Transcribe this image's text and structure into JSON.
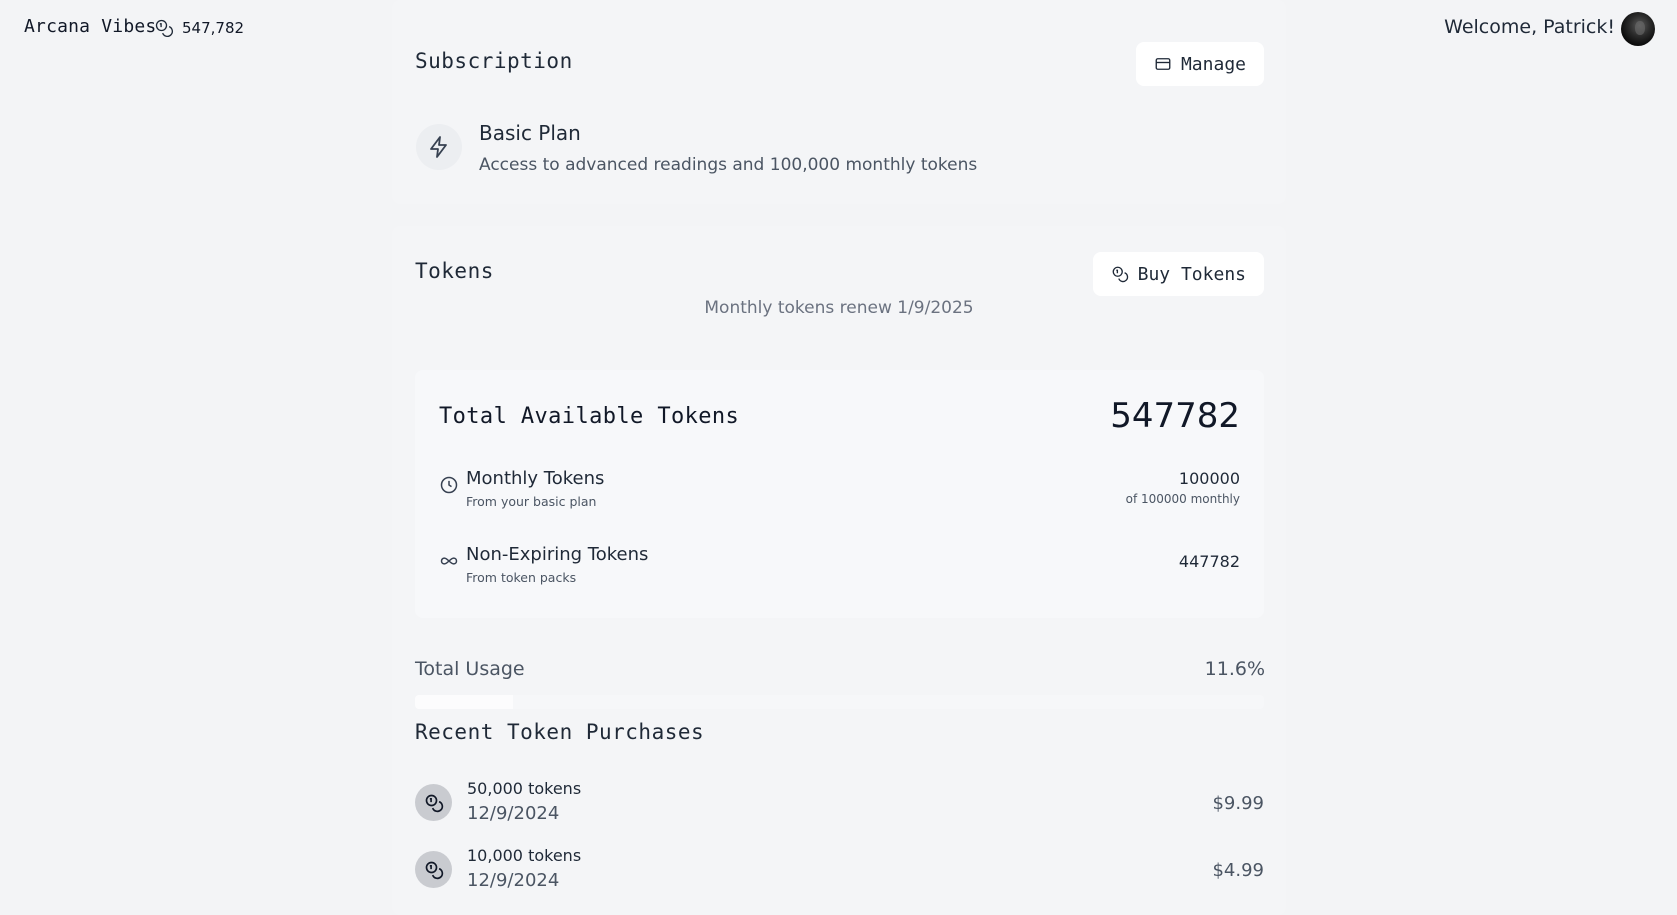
{
  "header": {
    "brand": "Arcana Vibes",
    "token_balance": "547,782",
    "welcome": "Welcome, Patrick!"
  },
  "subscription": {
    "title": "Subscription",
    "manage_label": "Manage",
    "plan_name": "Basic Plan",
    "plan_description": "Access to advanced readings and 100,000 monthly tokens"
  },
  "tokens": {
    "title": "Tokens",
    "buy_label": "Buy Tokens",
    "renew_text": "Monthly tokens renew 1/9/2025",
    "summary": {
      "title": "Total Available Tokens",
      "total": "547782",
      "monthly": {
        "label": "Monthly Tokens",
        "sub": "From your basic plan",
        "value": "100000",
        "value_sub": "of 100000 monthly"
      },
      "non_expiring": {
        "label": "Non-Expiring Tokens",
        "sub": "From token packs",
        "value": "447782"
      }
    },
    "usage": {
      "label": "Total Usage",
      "value": "11.6%",
      "fraction": 0.116
    }
  },
  "recent": {
    "title": "Recent Token Purchases",
    "items": [
      {
        "amount": "50,000 tokens",
        "date": "12/9/2024",
        "price": "$9.99"
      },
      {
        "amount": "10,000 tokens",
        "date": "12/9/2024",
        "price": "$4.99"
      }
    ]
  },
  "icons": {
    "balance": "coins-icon",
    "manage": "credit-card-icon",
    "buy": "coins-icon",
    "plan": "lightning-icon",
    "monthly": "clock-icon",
    "non_expiring": "infinity-icon",
    "purchase": "coins-icon"
  }
}
